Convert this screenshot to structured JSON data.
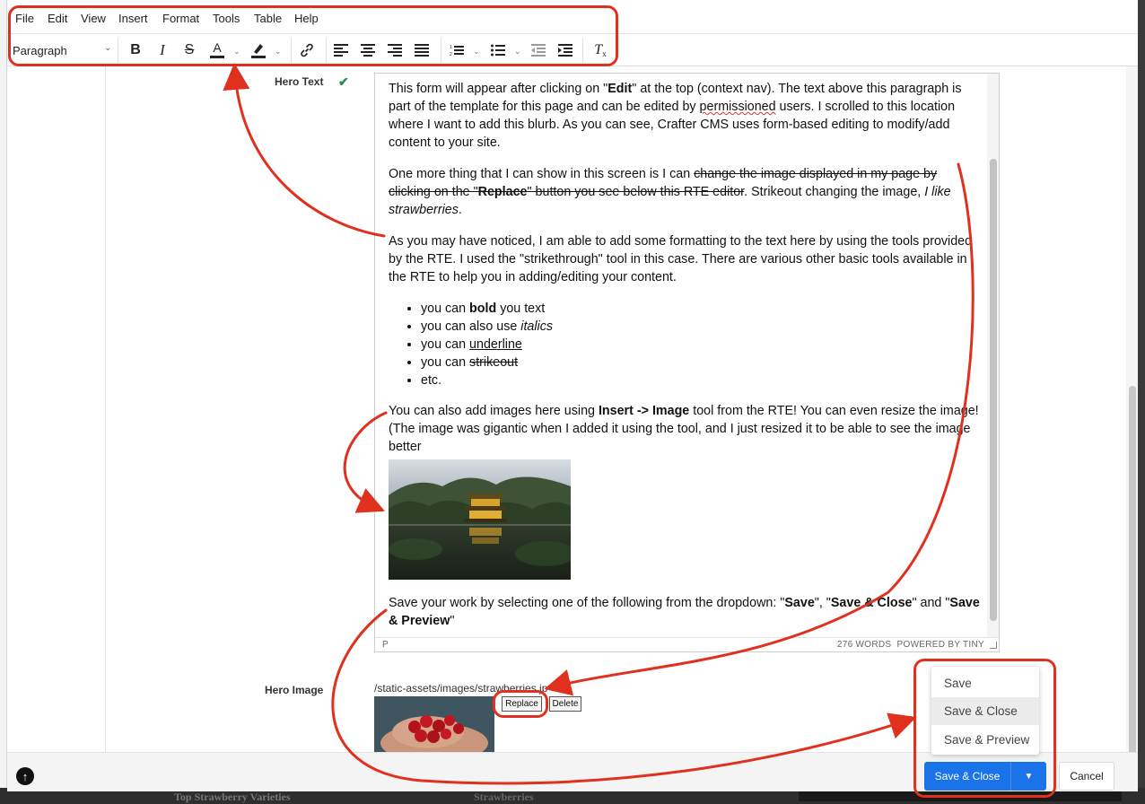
{
  "menubar": {
    "items": [
      "File",
      "Edit",
      "View",
      "Insert",
      "Format",
      "Tools",
      "Table",
      "Help"
    ]
  },
  "toolbar": {
    "block_format": "Paragraph"
  },
  "form": {
    "hero_text_label": "Hero Text",
    "hero_image_label": "Hero Image",
    "hero_image_path": "/static-assets/images/strawberries.jp",
    "replace_label": "Replace",
    "delete_label": "Delete"
  },
  "rte": {
    "p1": {
      "a": "This form will appear after clicking on \"",
      "b": "Edit",
      "c": "\" at the top (context nav).  The text above this paragraph is part of the template for this page and can be edited by ",
      "d": "permissioned",
      "e": " users.  I scrolled to this location where I want to add this blurb.  As you can see, Crafter CMS uses form-based editing to modify/add content to your site."
    },
    "p2": {
      "a": "One more thing that I can show in this screen is I can ",
      "b": "change the image displayed in my page by clicking on the \"",
      "c": "Replace",
      "d": "\" button you see below this RTE editor",
      "e": ".  Strikeout changing the image, ",
      "f": "I like strawberries",
      "g": "."
    },
    "p3": "As you may have noticed, I am able to add some formatting to the text here by using the tools provided by the RTE.  I used the \"strikethrough\" tool in this case.  There are various other basic tools available in the RTE to help you in adding/editing your content.",
    "list": {
      "prefix": "you can ",
      "bold": "bold",
      "bold_suffix": " you text",
      "italic_prefix": "you can also use ",
      "italic": "italics",
      "underline": "underline",
      "strike": "strikeout",
      "etc": "etc."
    },
    "p4": {
      "a": "You can also add images here using ",
      "b": "Insert -> Image",
      "c": " tool from the RTE!  You can even resize the image! (The image was gigantic when I added it using the tool, and I just resized it to be able to see the image better"
    },
    "p5": {
      "a": "Save your work by selecting one of the following from the dropdown: \"",
      "b": "Save",
      "c": "\", \"",
      "d": "Save & Close",
      "e": "\" and \"",
      "f": "Save & Preview",
      "g": "\""
    },
    "status_path": "P",
    "word_count": "276 WORDS",
    "powered_by": "POWERED BY TINY"
  },
  "save_menu": {
    "options": [
      "Save",
      "Save & Close",
      "Save & Preview"
    ],
    "highlighted": "Save & Close"
  },
  "footer": {
    "save_close": "Save & Close",
    "cancel": "Cancel"
  },
  "annotation_color": "#e0301e",
  "primary_color": "#1a73e8",
  "background_page": {
    "bottom_text": "Top Strawberry Varieties",
    "bottom_text_2": "Strawberries"
  }
}
